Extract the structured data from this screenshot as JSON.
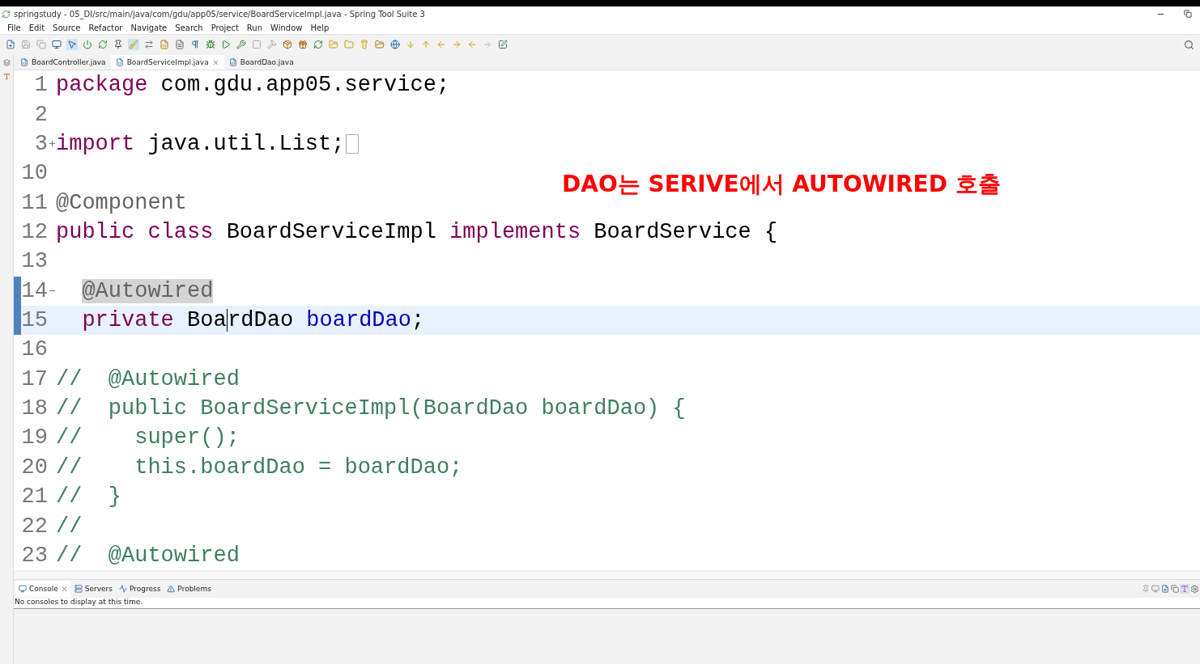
{
  "window": {
    "title": "springstudy - 05_DI/src/main/java/com/gdu/app05/service/BoardServiceImpl.java - Spring Tool Suite 3"
  },
  "menu": [
    "File",
    "Edit",
    "Source",
    "Refactor",
    "Navigate",
    "Search",
    "Project",
    "Run",
    "Window",
    "Help"
  ],
  "editor_tabs": [
    {
      "label": "BoardController.java",
      "selected": false,
      "closable": false
    },
    {
      "label": "BoardServiceImpl.java",
      "selected": true,
      "closable": true
    },
    {
      "label": "BoardDao.java",
      "selected": false,
      "closable": false
    }
  ],
  "code_lines": [
    {
      "number": "1",
      "current": false,
      "tokens": [
        {
          "kind": "keyword",
          "text": "package"
        },
        {
          "kind": "plain",
          "text": " com.gdu.app05.service;"
        }
      ]
    },
    {
      "number": "2",
      "current": false
    },
    {
      "number": "3",
      "current": false,
      "collapsible": true,
      "collapsed": true,
      "tokens": [
        {
          "kind": "keyword",
          "text": "import"
        },
        {
          "kind": "plain",
          "text": " java.util.List;"
        }
      ]
    },
    {
      "number": "10",
      "current": false
    },
    {
      "number": "11",
      "current": false,
      "tokens": [
        {
          "kind": "annotation",
          "text": "@Component"
        }
      ]
    },
    {
      "number": "12",
      "current": false,
      "tokens": [
        {
          "kind": "keyword",
          "text": "public"
        },
        {
          "kind": "keyword",
          "text": " class"
        },
        {
          "kind": "plain",
          "text": " BoardServiceImpl "
        },
        {
          "kind": "keyword",
          "text": "implements"
        },
        {
          "kind": "plain",
          "text": " BoardService {"
        }
      ]
    },
    {
      "number": "13",
      "current": false
    },
    {
      "number": "14",
      "current": false,
      "collapsible": true,
      "collapsed": false,
      "marked": true,
      "indented": true,
      "tokens": [
        {
          "kind": "annotation",
          "text": "@Autowired",
          "highlighted": true
        }
      ]
    },
    {
      "number": "15",
      "current": true,
      "marked": true,
      "indented": true,
      "tokens": [
        {
          "kind": "keyword",
          "text": "private"
        },
        {
          "kind": "plain",
          "text": " Boa",
          "caret_after": true
        },
        {
          "kind": "plain",
          "text": "rdDao "
        },
        {
          "kind": "field",
          "text": "boardDao"
        },
        {
          "kind": "plain",
          "text": ";"
        }
      ]
    },
    {
      "number": "16",
      "current": false
    },
    {
      "number": "17",
      "current": false,
      "tokens": [
        {
          "kind": "comment",
          "text": "//  @Autowired"
        }
      ]
    },
    {
      "number": "18",
      "current": false,
      "tokens": [
        {
          "kind": "comment",
          "text": "//  public BoardServiceImpl(BoardDao boardDao) {"
        }
      ]
    },
    {
      "number": "19",
      "current": false,
      "tokens": [
        {
          "kind": "comment",
          "text": "//    super();"
        }
      ]
    },
    {
      "number": "20",
      "current": false,
      "tokens": [
        {
          "kind": "comment",
          "text": "//    this.boardDao = boardDao;"
        }
      ]
    },
    {
      "number": "21",
      "current": false,
      "tokens": [
        {
          "kind": "comment",
          "text": "//  }"
        }
      ]
    },
    {
      "number": "22",
      "current": false,
      "tokens": [
        {
          "kind": "comment",
          "text": "//"
        }
      ]
    },
    {
      "number": "23",
      "current": false,
      "tokens": [
        {
          "kind": "comment",
          "text": "//  @Autowired"
        }
      ]
    }
  ],
  "overlay_note": {
    "text": "DAO는 SERIVE에서 AUTOWIRED 호출",
    "color": "#ff0000"
  },
  "bottom_tabs": [
    {
      "label": "Console",
      "selected": true,
      "closable": true
    },
    {
      "label": "Servers",
      "selected": false,
      "closable": false
    },
    {
      "label": "Progress",
      "selected": false,
      "closable": false
    },
    {
      "label": "Problems",
      "selected": false,
      "closable": false
    }
  ],
  "console_message": "No consoles to display at this time."
}
